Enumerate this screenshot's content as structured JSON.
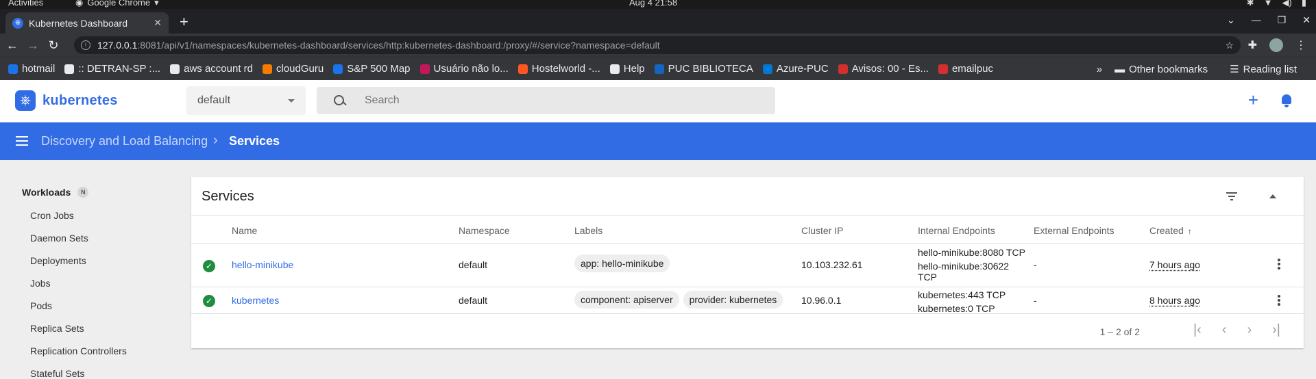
{
  "os": {
    "activities": "Activities",
    "app_name": "Google Chrome",
    "clock": "Aug 4  21:58"
  },
  "browser": {
    "tab_title": "Kubernetes Dashboard",
    "url_host": "127.0.0.1",
    "url_rest": ":8081/api/v1/namespaces/kubernetes-dashboard/services/http:kubernetes-dashboard:/proxy/#/service?namespace=default",
    "bookmarks": [
      {
        "label": "hotmail",
        "color": "#1a73e8"
      },
      {
        "label": ":: DETRAN-SP :...",
        "color": "#e8eaed"
      },
      {
        "label": "aws account rd",
        "color": "#e8eaed"
      },
      {
        "label": "cloudGuru",
        "color": "#f57c00"
      },
      {
        "label": "S&P 500 Map",
        "color": "#1a73e8"
      },
      {
        "label": "Usuário não lo...",
        "color": "#c2185b"
      },
      {
        "label": "Hostelworld -...",
        "color": "#ff5722"
      },
      {
        "label": "Help",
        "color": "#e8eaed"
      },
      {
        "label": "PUC BIBLIOTECA",
        "color": "#1565c0"
      },
      {
        "label": "Azure-PUC",
        "color": "#0078d4"
      },
      {
        "label": "Avisos: 00 - Es...",
        "color": "#d32f2f"
      },
      {
        "label": "emailpuc",
        "color": "#d32f2f"
      }
    ],
    "overflow_label": "»",
    "other_bookmarks": "Other bookmarks",
    "reading_list": "Reading list"
  },
  "header": {
    "brand": "kubernetes",
    "namespace": "default",
    "search_placeholder": "Search"
  },
  "toolbar": {
    "section": "Discovery and Load Balancing",
    "page": "Services"
  },
  "sidebar": {
    "section": "Workloads",
    "badge": "N",
    "items": [
      "Cron Jobs",
      "Daemon Sets",
      "Deployments",
      "Jobs",
      "Pods",
      "Replica Sets",
      "Replication Controllers",
      "Stateful Sets"
    ]
  },
  "services": {
    "title": "Services",
    "columns": [
      "Name",
      "Namespace",
      "Labels",
      "Cluster IP",
      "Internal Endpoints",
      "External Endpoints",
      "Created"
    ],
    "rows": [
      {
        "name": "hello-minikube",
        "namespace": "default",
        "labels": [
          "app: hello-minikube"
        ],
        "cluster_ip": "10.103.232.61",
        "internal_endpoints": [
          "hello-minikube:8080 TCP",
          "hello-minikube:30622",
          "TCP"
        ],
        "external_endpoints": "-",
        "created": "7 hours ago"
      },
      {
        "name": "kubernetes",
        "namespace": "default",
        "labels": [
          "component: apiserver",
          "provider: kubernetes"
        ],
        "cluster_ip": "10.96.0.1",
        "internal_endpoints": [
          "kubernetes:443 TCP",
          "kubernetes:0 TCP"
        ],
        "external_endpoints": "-",
        "created": "8 hours ago"
      }
    ],
    "pager": "1 – 2 of 2"
  },
  "colors": {
    "brand": "#326ce5",
    "status_ok": "#1e8e3e"
  }
}
